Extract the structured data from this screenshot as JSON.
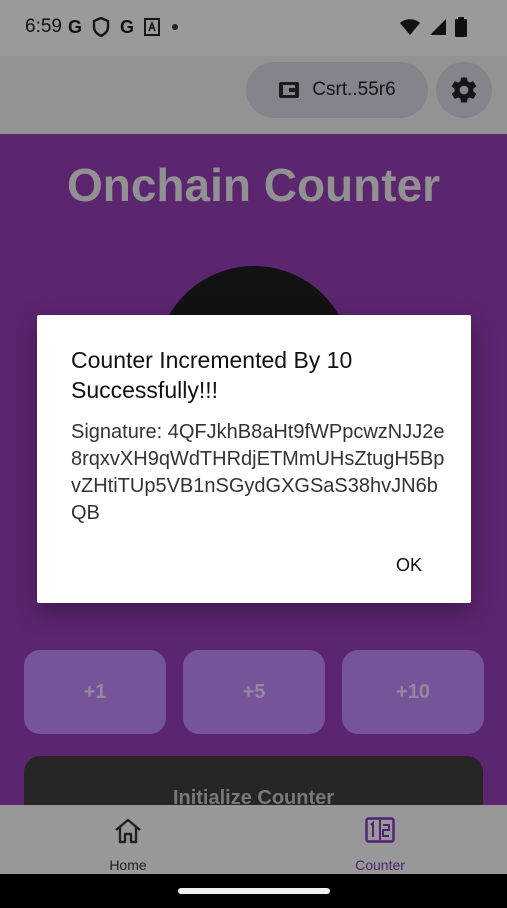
{
  "status_bar": {
    "time": "6:59",
    "left_icons": [
      "google-g-icon",
      "shield-icon",
      "google-g-icon",
      "a-box-icon",
      "dot-icon"
    ],
    "right_icons": [
      "wifi-icon",
      "signal-icon",
      "battery-icon"
    ]
  },
  "header": {
    "wallet_label": "Csrt..55r6",
    "wallet_icon": "wallet-icon",
    "settings_icon": "gear-icon"
  },
  "main": {
    "title": "Onchain Counter",
    "increment_buttons": [
      "+1",
      "+5",
      "+10"
    ],
    "initialize_label": "Initialize Counter"
  },
  "nav": {
    "items": [
      {
        "label": "Home",
        "icon": "home-icon"
      },
      {
        "label": "Counter",
        "icon": "counter-icon"
      }
    ]
  },
  "dialog": {
    "title": "Counter Incremented By 10 Successfully!!!",
    "message": "Signature: 4QFJkhB8aHt9fWPpcwzNJJ2e8rqxvXH9qWdTHRdjETMmUHsZtugH5BpvZHtiTUp5VB1nSGydGXGSaS38hvJN6bQB",
    "ok_label": "OK"
  },
  "colors": {
    "purple": "#8a38a6",
    "button_purple": "#b07ee6"
  }
}
